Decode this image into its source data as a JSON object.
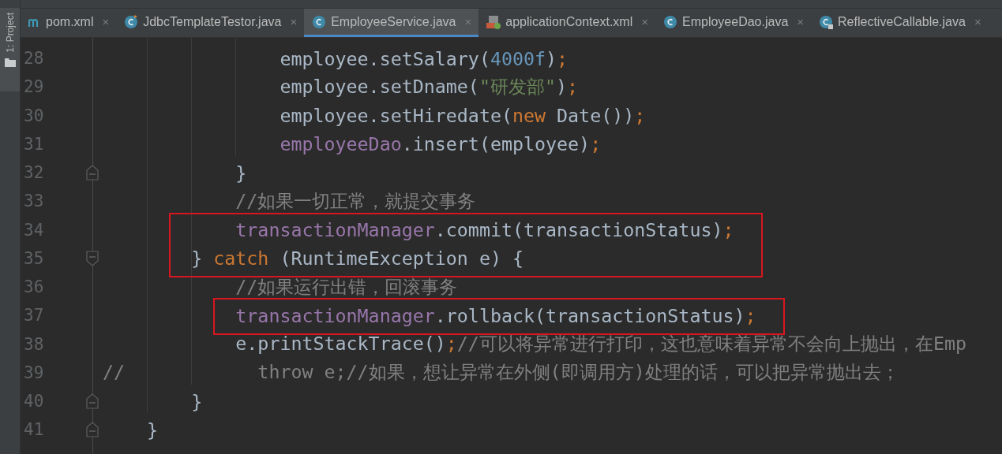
{
  "sidebar": {
    "tool_window": "1: Project",
    "selected": true
  },
  "tabs": [
    {
      "label": "pom.xml",
      "kind": "maven",
      "close": "×",
      "selected": false
    },
    {
      "label": "JdbcTemplateTestor.java",
      "kind": "class-run",
      "close": "×",
      "selected": false
    },
    {
      "label": "EmployeeService.java",
      "kind": "class",
      "close": "×",
      "selected": true
    },
    {
      "label": "applicationContext.xml",
      "kind": "xml",
      "close": "×",
      "selected": false
    },
    {
      "label": "EmployeeDao.java",
      "kind": "class",
      "close": "×",
      "selected": false
    },
    {
      "label": "ReflectiveCallable.java",
      "kind": "class-locked",
      "close": "×",
      "selected": false
    }
  ],
  "lines": [
    {
      "number": "28",
      "kind": "plain",
      "highlight": false,
      "tokens": [
        {
          "kind": "plain",
          "t": "                employee.setSalary("
        },
        {
          "kind": "number",
          "t": "4000f"
        },
        {
          "kind": "plain",
          "t": ")"
        },
        {
          "kind": "keyword",
          "t": ";"
        }
      ]
    },
    {
      "number": "29",
      "kind": "plain",
      "highlight": false,
      "tokens": [
        {
          "kind": "plain",
          "t": "                employee.setDname("
        },
        {
          "kind": "string",
          "t": "\"研发部\""
        },
        {
          "kind": "plain",
          "t": ")"
        },
        {
          "kind": "keyword",
          "t": ";"
        }
      ]
    },
    {
      "number": "30",
      "kind": "plain",
      "highlight": false,
      "tokens": [
        {
          "kind": "plain",
          "t": "                employee.setHiredate("
        },
        {
          "kind": "keyword",
          "t": "new"
        },
        {
          "kind": "plain",
          "t": " Date())"
        },
        {
          "kind": "keyword",
          "t": ";"
        }
      ]
    },
    {
      "number": "31",
      "kind": "plain",
      "highlight": false,
      "tokens": [
        {
          "kind": "field",
          "t": "                employeeDao"
        },
        {
          "kind": "plain",
          "t": ".insert(employee)"
        },
        {
          "kind": "keyword",
          "t": ";"
        }
      ]
    },
    {
      "number": "32",
      "kind": "fold-end",
      "highlight": false,
      "tokens": [
        {
          "kind": "plain",
          "t": "            }"
        }
      ]
    },
    {
      "number": "33",
      "kind": "plain",
      "highlight": false,
      "tokens": [
        {
          "kind": "comment",
          "t": "            //如果一切正常，就提交事务"
        }
      ]
    },
    {
      "number": "34",
      "kind": "plain",
      "highlight": true,
      "tokens": [
        {
          "kind": "field",
          "t": "            transactionManager"
        },
        {
          "kind": "plain",
          "t": ".commit(transactionStatus)"
        },
        {
          "kind": "keyword",
          "t": ";"
        }
      ]
    },
    {
      "number": "35",
      "kind": "fold-start",
      "highlight": true,
      "tokens": [
        {
          "kind": "plain",
          "t": "        } "
        },
        {
          "kind": "keyword",
          "t": "catch"
        },
        {
          "kind": "plain",
          "t": " (RuntimeException e) {"
        }
      ]
    },
    {
      "number": "36",
      "kind": "plain",
      "highlight": false,
      "tokens": [
        {
          "kind": "comment",
          "t": "            //如果运行出错，回滚事务"
        }
      ]
    },
    {
      "number": "37",
      "kind": "plain",
      "highlight": true,
      "tokens": [
        {
          "kind": "field",
          "t": "            transactionManager"
        },
        {
          "kind": "plain",
          "t": ".rollback(transactionStatus)"
        },
        {
          "kind": "keyword",
          "t": ";"
        }
      ]
    },
    {
      "number": "38",
      "kind": "plain",
      "highlight": false,
      "tokens": [
        {
          "kind": "plain",
          "t": "            e.printStackTrace()"
        },
        {
          "kind": "keyword",
          "t": ";"
        },
        {
          "kind": "comment",
          "t": "//可以将异常进行打印，这也意味着异常不会向上抛出，在Emp"
        }
      ]
    },
    {
      "number": "39",
      "kind": "plain",
      "highlight": false,
      "tokens": [
        {
          "kind": "comment",
          "t": "//            throw e;//如果，想让异常在外侧(即调用方)处理的话，可以把异常抛出去；"
        }
      ]
    },
    {
      "number": "40",
      "kind": "fold-end",
      "highlight": false,
      "tokens": [
        {
          "kind": "plain",
          "t": "        }"
        }
      ]
    },
    {
      "number": "41",
      "kind": "fold-end",
      "highlight": false,
      "tokens": [
        {
          "kind": "plain",
          "t": "    }"
        }
      ]
    }
  ]
}
